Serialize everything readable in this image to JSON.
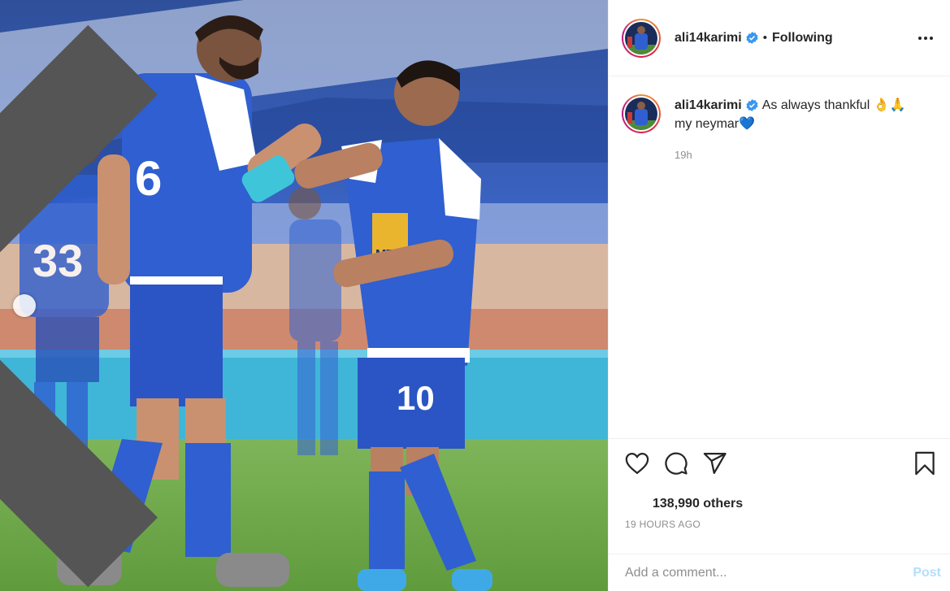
{
  "post": {
    "username": "ali14karimi",
    "following_label": "Following",
    "dot": "•",
    "caption_username": "ali14karimi",
    "caption_line1": "As always thankful 👌🙏",
    "caption_line2": "my neymar💙",
    "caption_time": "19h",
    "likes_label": "138,990 others",
    "timestamp": "19 HOURS AGO"
  },
  "photo": {
    "jersey_numbers": [
      "6",
      "33",
      "10"
    ],
    "sponsor": "MTN"
  },
  "composer": {
    "placeholder": "Add a comment...",
    "post_label": "Post"
  },
  "icons": {
    "verified": "verified-badge-icon",
    "more": "more-options-icon",
    "like": "heart-icon",
    "comment": "comment-bubble-icon",
    "share": "share-paper-plane-icon",
    "save": "bookmark-icon",
    "prev": "chevron-left-icon"
  },
  "colors": {
    "verified_blue": "#3897f0",
    "post_button": "#b2dffc",
    "kit_blue": "#2f5fd0"
  }
}
